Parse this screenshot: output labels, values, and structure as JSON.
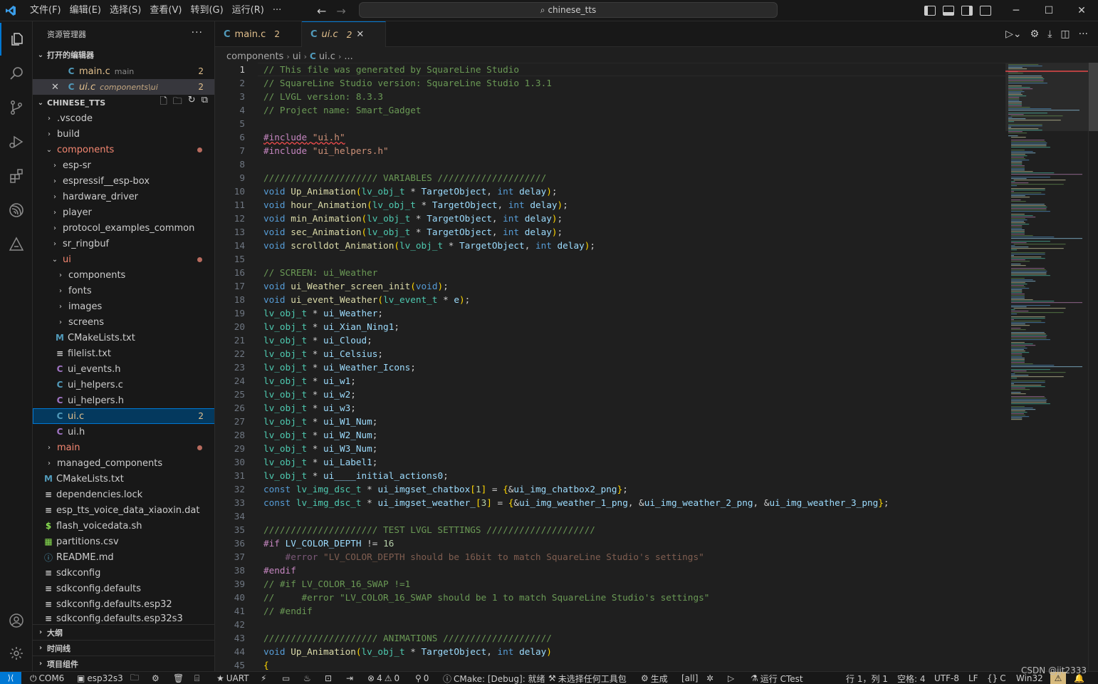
{
  "titlebar": {
    "menu": [
      "文件(F)",
      "编辑(E)",
      "选择(S)",
      "查看(V)",
      "转到(G)",
      "运行(R)",
      "···"
    ],
    "search_text": "chinese_tts"
  },
  "sidebar": {
    "title": "资源管理器",
    "open_editors_label": "打开的编辑器",
    "open_editors": [
      {
        "name": "main.c",
        "desc": "main",
        "count": "2"
      },
      {
        "name": "ui.c",
        "desc": "components\\ui",
        "count": "2"
      }
    ],
    "project_label": "CHINESE_TTS",
    "tree": [
      {
        "label": ".vscode"
      },
      {
        "label": "build"
      },
      {
        "label": "components"
      },
      {
        "label": "esp-sr"
      },
      {
        "label": "espressif__esp-box"
      },
      {
        "label": "hardware_driver"
      },
      {
        "label": "player"
      },
      {
        "label": "protocol_examples_common"
      },
      {
        "label": "sr_ringbuf"
      },
      {
        "label": "ui"
      },
      {
        "label": "components"
      },
      {
        "label": "fonts"
      },
      {
        "label": "images"
      },
      {
        "label": "screens"
      },
      {
        "label": "CMakeLists.txt"
      },
      {
        "label": "filelist.txt"
      },
      {
        "label": "ui_events.h"
      },
      {
        "label": "ui_helpers.c"
      },
      {
        "label": "ui_helpers.h"
      },
      {
        "label": "ui.c",
        "badge": "2"
      },
      {
        "label": "ui.h"
      },
      {
        "label": "main"
      },
      {
        "label": "managed_components"
      },
      {
        "label": "CMakeLists.txt"
      },
      {
        "label": "dependencies.lock"
      },
      {
        "label": "esp_tts_voice_data_xiaoxin.dat"
      },
      {
        "label": "flash_voicedata.sh"
      },
      {
        "label": "partitions.csv"
      },
      {
        "label": "README.md"
      },
      {
        "label": "sdkconfig"
      },
      {
        "label": "sdkconfig.defaults"
      },
      {
        "label": "sdkconfig.defaults.esp32"
      },
      {
        "label": "sdkconfig.defaults.esp32s3"
      }
    ],
    "bottom_sections": [
      "大纲",
      "时间线",
      "项目组件"
    ]
  },
  "tabs": [
    {
      "label": "main.c",
      "count": "2"
    },
    {
      "label": "ui.c",
      "count": "2"
    }
  ],
  "breadcrumb": [
    "components",
    "ui",
    "ui.c",
    "..."
  ],
  "code": [
    "// This file was generated by SquareLine Studio",
    "// SquareLine Studio version: SquareLine Studio 1.3.1",
    "// LVGL version: 8.3.3",
    "// Project name: Smart_Gadget",
    "",
    "#include \"ui.h\"",
    "#include \"ui_helpers.h\"",
    "",
    "///////////////////// VARIABLES ////////////////////",
    "void Up_Animation(lv_obj_t * TargetObject, int delay);",
    "void hour_Animation(lv_obj_t * TargetObject, int delay);",
    "void min_Animation(lv_obj_t * TargetObject, int delay);",
    "void sec_Animation(lv_obj_t * TargetObject, int delay);",
    "void scrolldot_Animation(lv_obj_t * TargetObject, int delay);",
    "",
    "// SCREEN: ui_Weather",
    "void ui_Weather_screen_init(void);",
    "void ui_event_Weather(lv_event_t * e);",
    "lv_obj_t * ui_Weather;",
    "lv_obj_t * ui_Xian_Ning1;",
    "lv_obj_t * ui_Cloud;",
    "lv_obj_t * ui_Celsius;",
    "lv_obj_t * ui_Weather_Icons;",
    "lv_obj_t * ui_w1;",
    "lv_obj_t * ui_w2;",
    "lv_obj_t * ui_w3;",
    "lv_obj_t * ui_W1_Num;",
    "lv_obj_t * ui_W2_Num;",
    "lv_obj_t * ui_W3_Num;",
    "lv_obj_t * ui_Label1;",
    "lv_obj_t * ui____initial_actions0;",
    "const lv_img_dsc_t * ui_imgset_chatbox[1] = {&ui_img_chatbox2_png};",
    "const lv_img_dsc_t * ui_imgset_weather_[3] = {&ui_img_weather_1_png, &ui_img_weather_2_png, &ui_img_weather_3_png};",
    "",
    "///////////////////// TEST LVGL SETTINGS ////////////////////",
    "#if LV_COLOR_DEPTH != 16",
    "    #error \"LV_COLOR_DEPTH should be 16bit to match SquareLine Studio's settings\"",
    "#endif",
    "// #if LV_COLOR_16_SWAP !=1",
    "//     #error \"LV_COLOR_16_SWAP should be 1 to match SquareLine Studio's settings\"",
    "// #endif",
    "",
    "///////////////////// ANIMATIONS ////////////////////",
    "void Up_Animation(lv_obj_t * TargetObject, int delay)",
    "{"
  ],
  "statusbar": {
    "port": "COM6",
    "target": "esp32s3",
    "uart": "UART",
    "errors": "4",
    "warnings": "0",
    "ports": "0",
    "cmake": "CMake: [Debug]: 就绪",
    "kit": "未选择任何工具包",
    "build": "生成",
    "target_all": "[all]",
    "ctest": "运行 CTest",
    "position": "行 1，列 1",
    "spaces": "空格: 4",
    "encoding": "UTF-8",
    "eol": "LF",
    "lang": "C",
    "platform": "Win32"
  },
  "watermark": "CSDN @jjt2333",
  "icons": [
    "files-icon",
    "search-icon",
    "source-control-icon",
    "run-debug-icon",
    "extensions-icon",
    "espressif-icon",
    "idf-icon",
    "account-icon",
    "settings-icon"
  ]
}
